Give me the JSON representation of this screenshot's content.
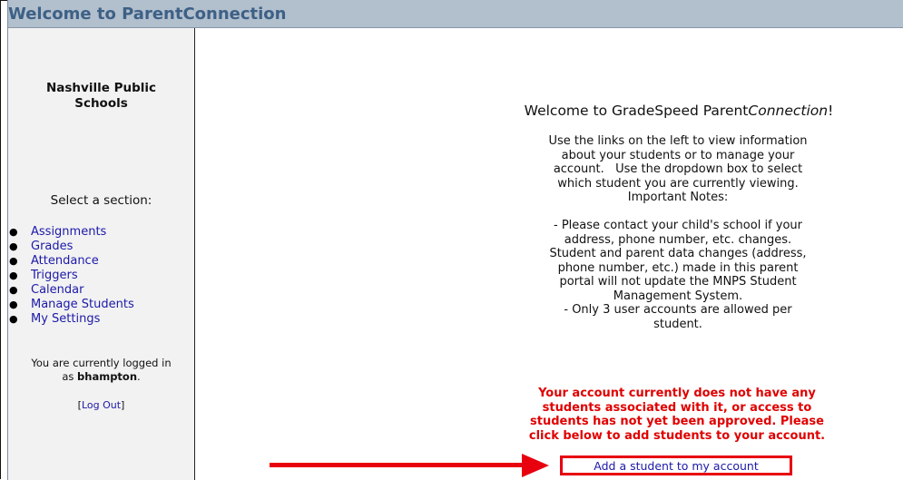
{
  "header": {
    "title": "Welcome to ParentConnection"
  },
  "sidebar": {
    "school_name_line1": "Nashville Public",
    "school_name_line2": "Schools",
    "select_label": "Select a section:",
    "nav_items": [
      {
        "label": "Assignments"
      },
      {
        "label": "Grades"
      },
      {
        "label": "Attendance"
      },
      {
        "label": "Triggers"
      },
      {
        "label": "Calendar"
      },
      {
        "label": "Manage Students"
      },
      {
        "label": "My Settings"
      }
    ],
    "logged_in_prefix": "You are currently logged in",
    "logged_in_as": "as",
    "username": "bhampton",
    "logout_label": "Log Out"
  },
  "main": {
    "welcome_prefix": "Welcome to GradeSpeed Parent",
    "welcome_italic": "Connection",
    "welcome_suffix": "!",
    "info_lines": [
      "Use the links on the left to view information",
      "about your students or to manage your",
      "account.   Use the dropdown box to select",
      "which student you are currently viewing.",
      "Important Notes:",
      "",
      "- Please contact your child's school if your",
      "address, phone number, etc. changes.",
      "Student and parent data changes (address,",
      "phone number, etc.) made in this parent",
      "portal will not update the MNPS Student",
      "Management System.",
      "- Only 3 user accounts are allowed per",
      "student."
    ],
    "warning_lines": [
      "Your account currently does not have any",
      "students associated with it, or access to",
      "students has not yet been approved. Please",
      "click below to add students to your account."
    ],
    "add_student_link": "Add a student to my account"
  },
  "colors": {
    "title_bar": "#b2bfcc",
    "title_text": "#3d6086",
    "link": "#1c19a8",
    "warning": "#e00000",
    "annotation": "#e8000f"
  }
}
